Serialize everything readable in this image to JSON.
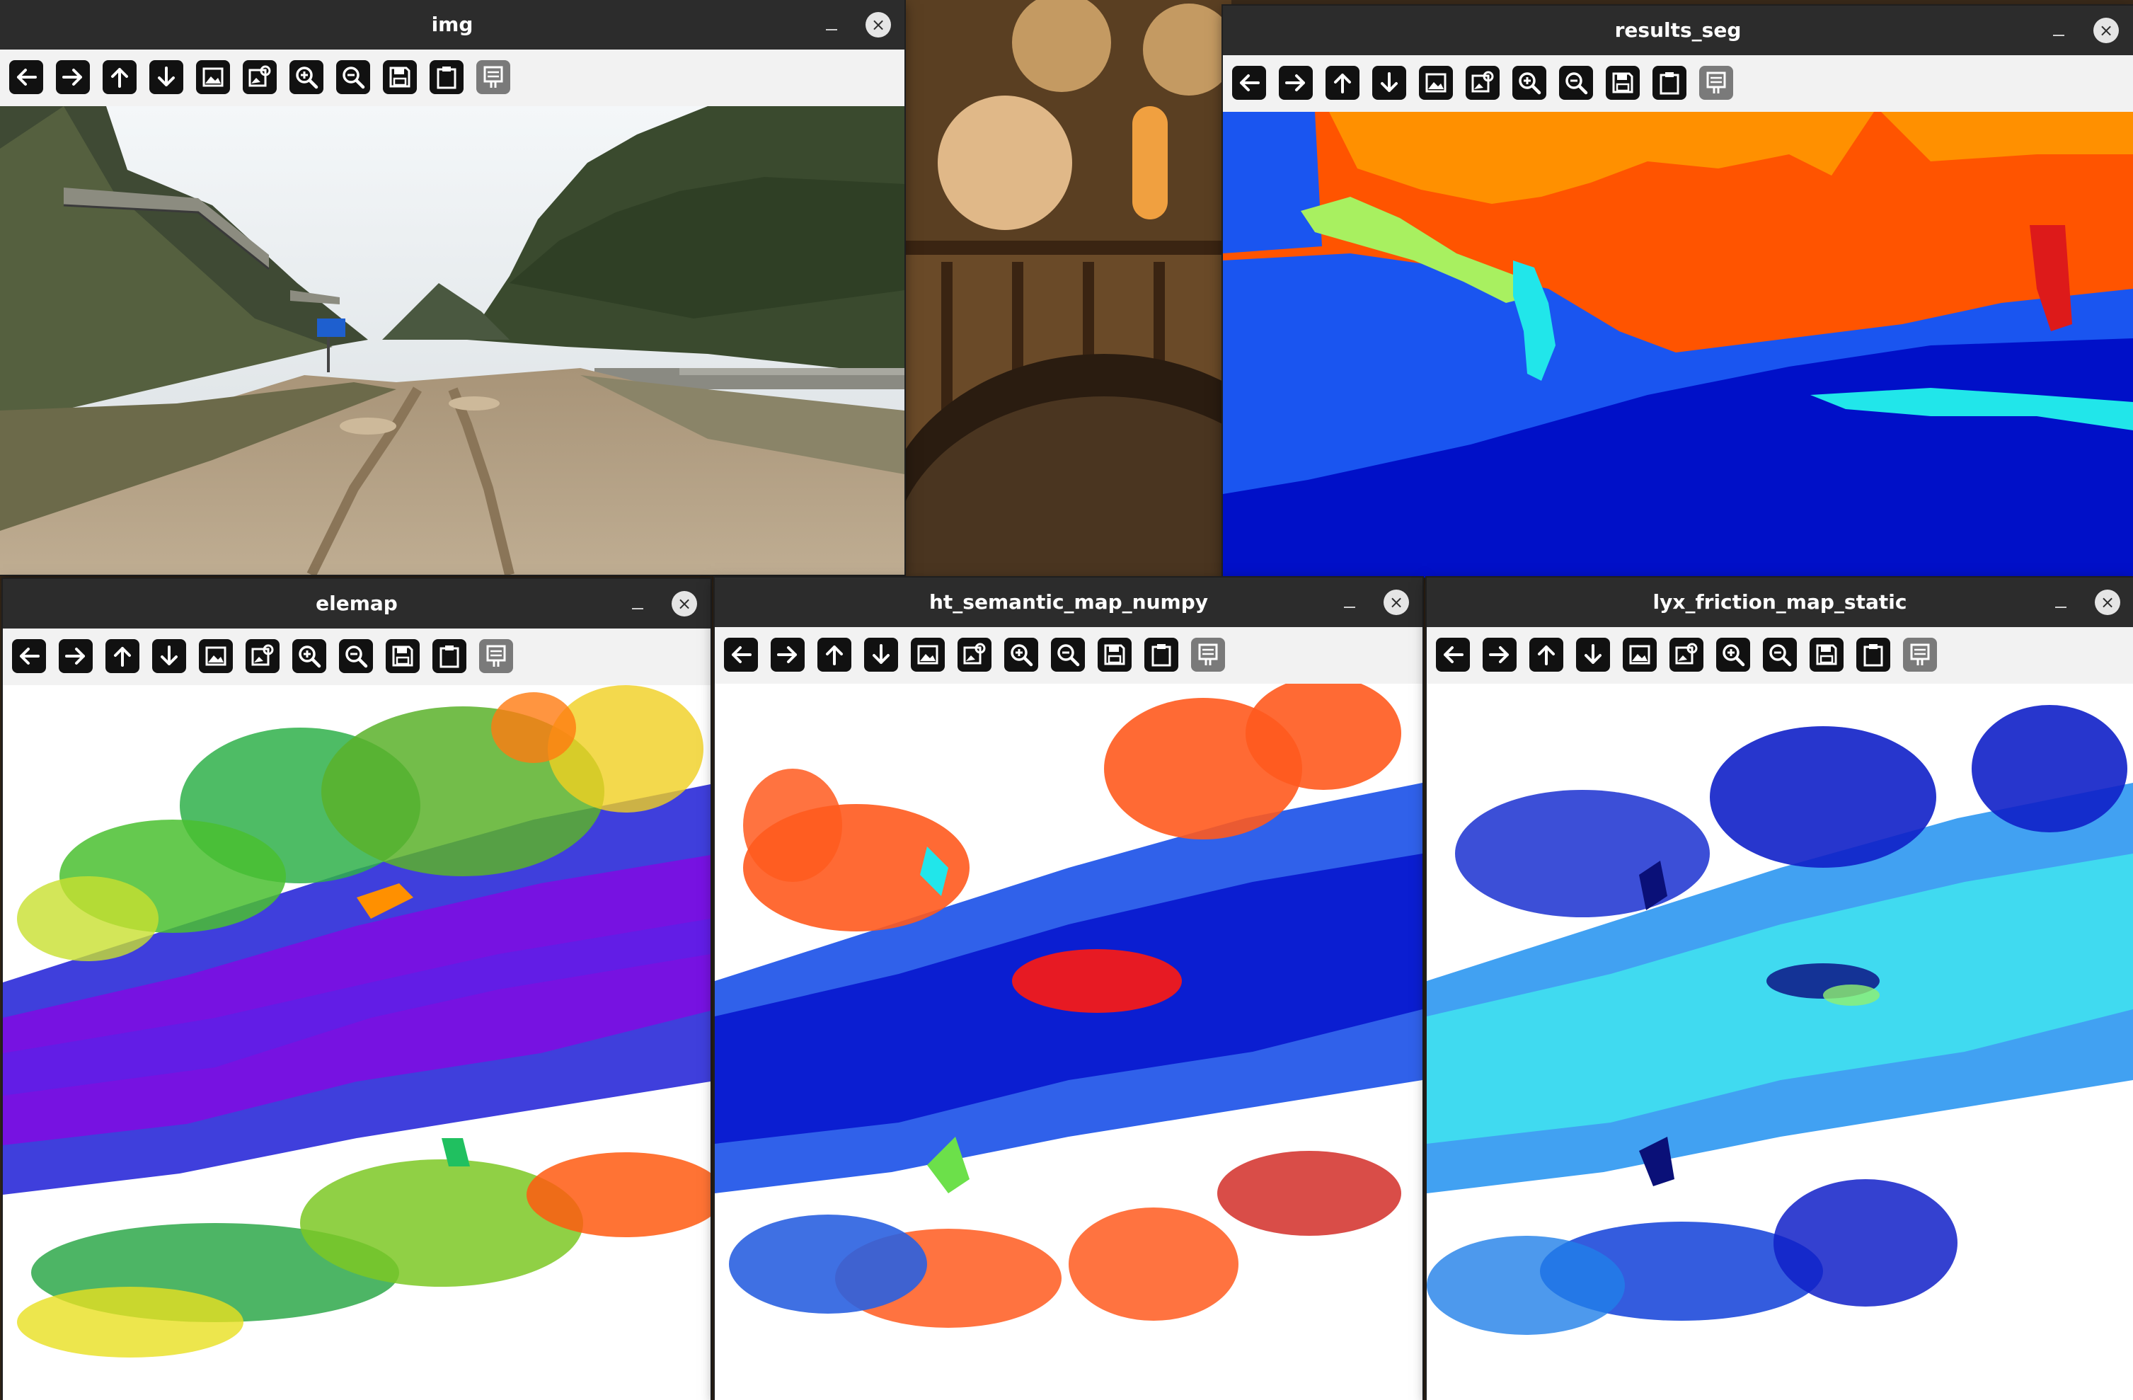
{
  "windows": {
    "img": {
      "title": "img"
    },
    "results_seg": {
      "title": "results_seg"
    },
    "elemap": {
      "title": "elemap"
    },
    "semantic": {
      "title": "ht_semantic_map_numpy"
    },
    "friction": {
      "title": "lyx_friction_map_static"
    }
  },
  "titlebar_buttons": {
    "minimize": "–",
    "close": "×"
  },
  "toolbar_icons": [
    "arrow-left-icon",
    "arrow-right-icon",
    "arrow-up-icon",
    "arrow-down-icon",
    "image-icon",
    "image-settings-icon",
    "zoom-in-icon",
    "zoom-out-icon",
    "save-icon",
    "clipboard-icon",
    "properties-icon"
  ],
  "colors": {
    "titlebar": "#2c2c2c",
    "toolbar": "#f2f2f2",
    "seg_sky": "#ff9000",
    "seg_trees": "#ff5400",
    "seg_vegetation_light": "#a8f060",
    "seg_cyan": "#21e6ea",
    "seg_road": "#1a55f0",
    "seg_ground_dark": "#0010c8",
    "elemap_low": "#7a10e0",
    "elemap_high": "#ff3a00",
    "semantic_class_a": "#ff5a1e",
    "semantic_class_b": "#1040e0",
    "friction_low": "#1020c8",
    "friction_high": "#40e0f0"
  }
}
